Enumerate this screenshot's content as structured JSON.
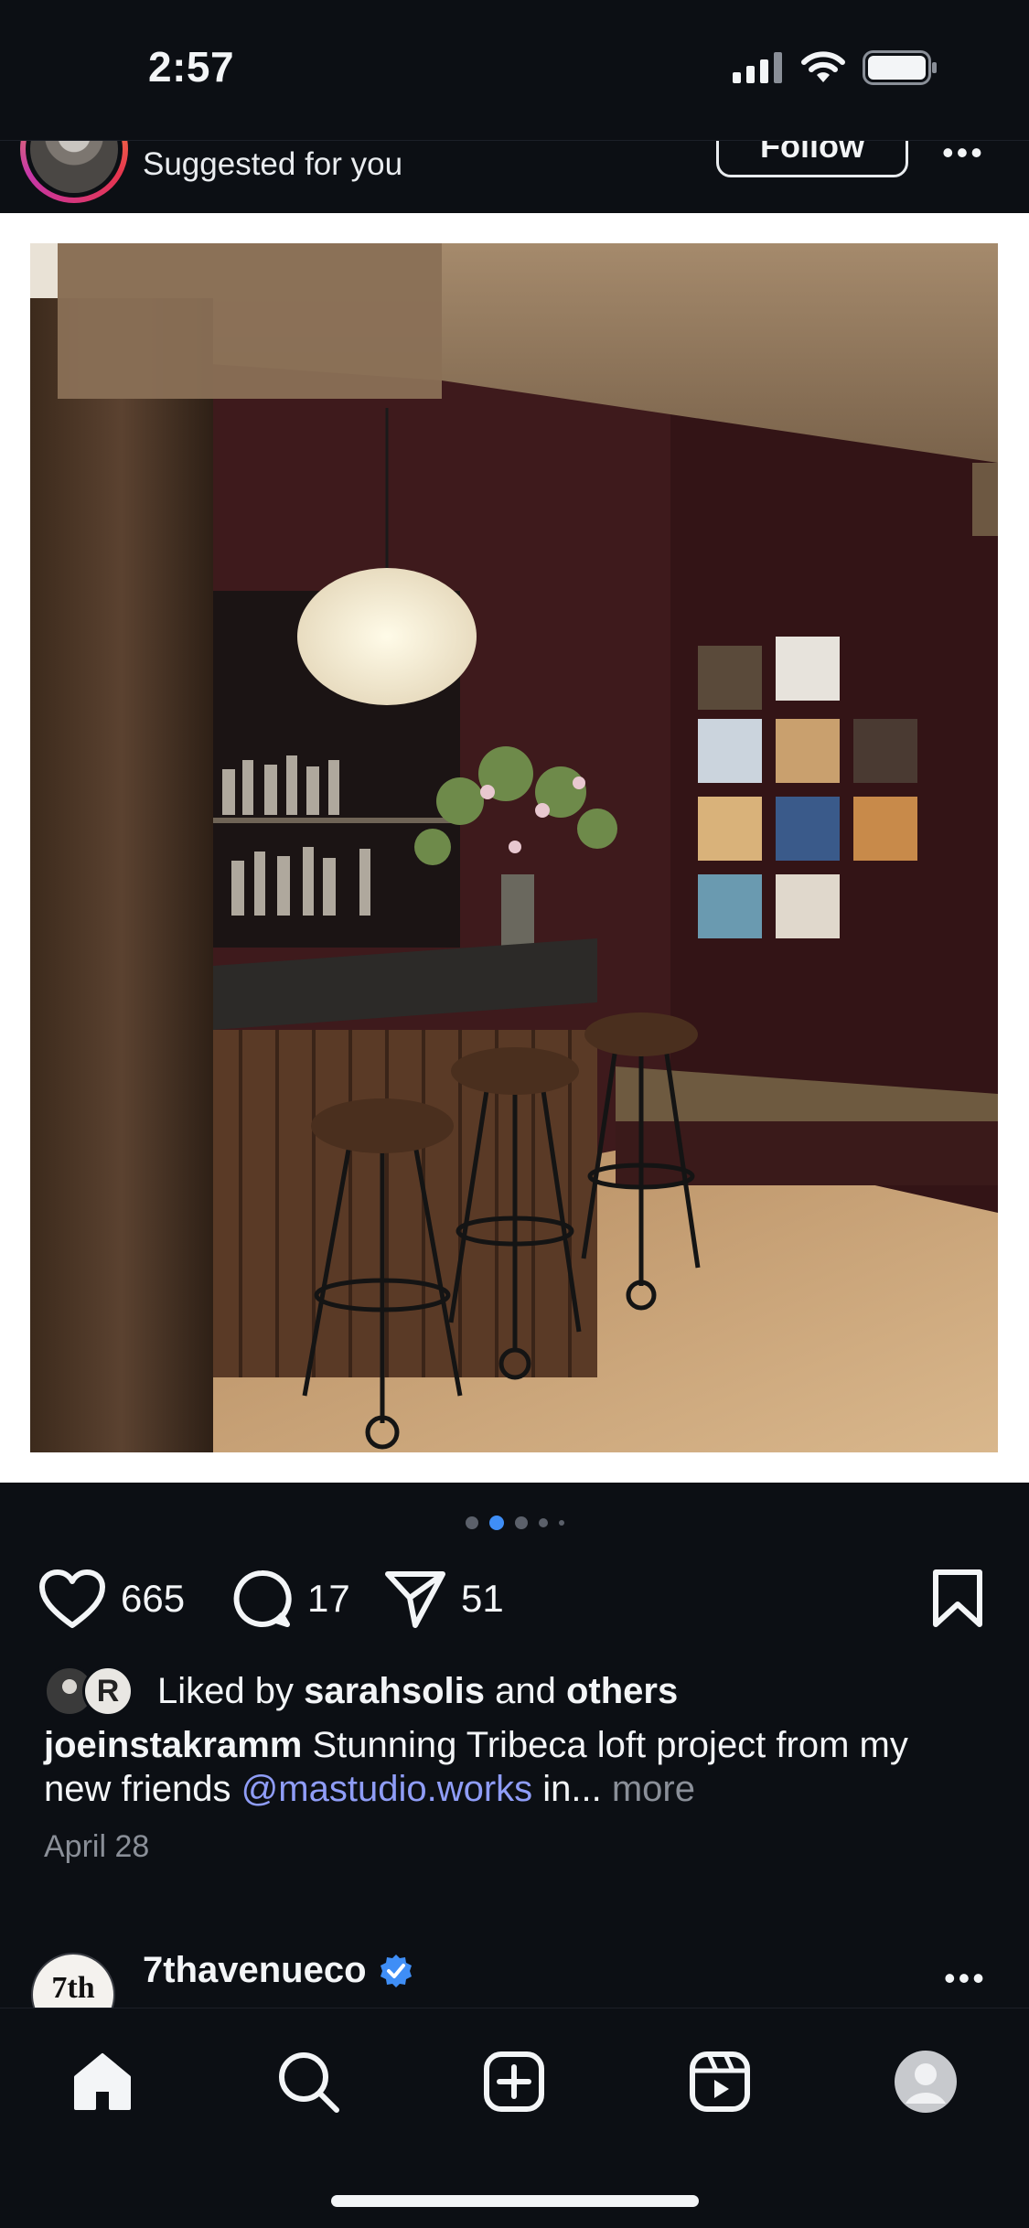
{
  "status_bar": {
    "time": "2:57"
  },
  "post": {
    "header": {
      "subtitle": "Suggested for you",
      "follow_label": "Follow",
      "more_label": "•••"
    },
    "carousel": {
      "count": 5,
      "active_index": 1
    },
    "actions": {
      "likes": "665",
      "comments": "17",
      "shares": "51"
    },
    "liked_by": {
      "prefix": "Liked by ",
      "user": "sarahsolis",
      "middle": " and ",
      "others": "others",
      "avatar2_initial": "R"
    },
    "caption": {
      "username": "joeinstakramm",
      "text_before": " Stunning Tribeca loft project from my new friends ",
      "mention": "@mastudio.works",
      "text_after": " in... ",
      "more": "more"
    },
    "date": "April 28"
  },
  "next_post": {
    "username": "7thavenueco",
    "avatar_text": "7th",
    "more_label": "•••"
  },
  "tabs": [
    "home",
    "search",
    "create",
    "reels",
    "profile"
  ],
  "colors": {
    "verified": "#3f8ef6",
    "mention": "#8f9df7",
    "background": "#0c0f14"
  }
}
